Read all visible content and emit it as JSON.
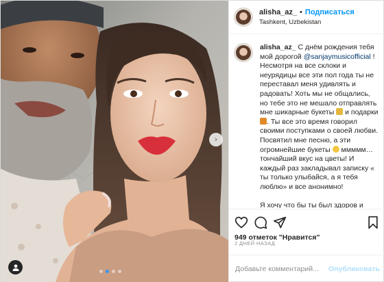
{
  "photo": {
    "description_icon": "photo-carousel",
    "next_icon": "chevron-right-icon",
    "next_glyph": "›",
    "tag_icon": "user-tag-icon",
    "carousel": {
      "count": 4,
      "active_index": 1
    }
  },
  "header": {
    "username": "alisha_az_",
    "separator": "•",
    "follow_label": "Подписаться",
    "location": "Tashkent, Uzbekistan"
  },
  "caption": {
    "username": "alisha_az_",
    "part1": "С днём рождения тебя мой дорогой ",
    "mention": "@sanjaymusicofficial",
    "part2": " ! Несмотря на все склоки и неурядицы все эти пол года ты не переставал меня удивлять и радовать! Хоть мы не общались, но тебе это не мешало отправлять мне шикарные букеты ",
    "part3": " и подарки ",
    "part4": ". Ты все это время говорил своими поступками о своей любви. Посвятил мне песню, а эти огромнейшие букеты ",
    "part5": " ммммм… тончайший вкус на цветы! И каждый раз закладывал записку « ты только улыбайся, а я тебя люблю» и все анонимно!",
    "paragraph2": "Я хочу что бы ты был здоров и бодр. Твоя забота безгранична и ты окутываешь меня ею. Я тебе",
    "emoji_icons": [
      "bouquet-emoji",
      "gift-emoji",
      "smile-emoji"
    ]
  },
  "actions": {
    "like_icon": "heart-icon",
    "comment_icon": "comment-icon",
    "share_icon": "share-icon",
    "save_icon": "bookmark-icon",
    "likes_count": "949",
    "likes_text": " отметок \"Нравится\""
  },
  "date": "2 дней назад",
  "comment": {
    "placeholder": "Добавьте комментарий...",
    "publish_label": "Опубликовать"
  },
  "colors": {
    "accent": "#0095f6",
    "publish_disabled": "#b2dffc",
    "mention": "#00376b",
    "muted": "#8e8e8e",
    "lips": "#d8303a"
  }
}
